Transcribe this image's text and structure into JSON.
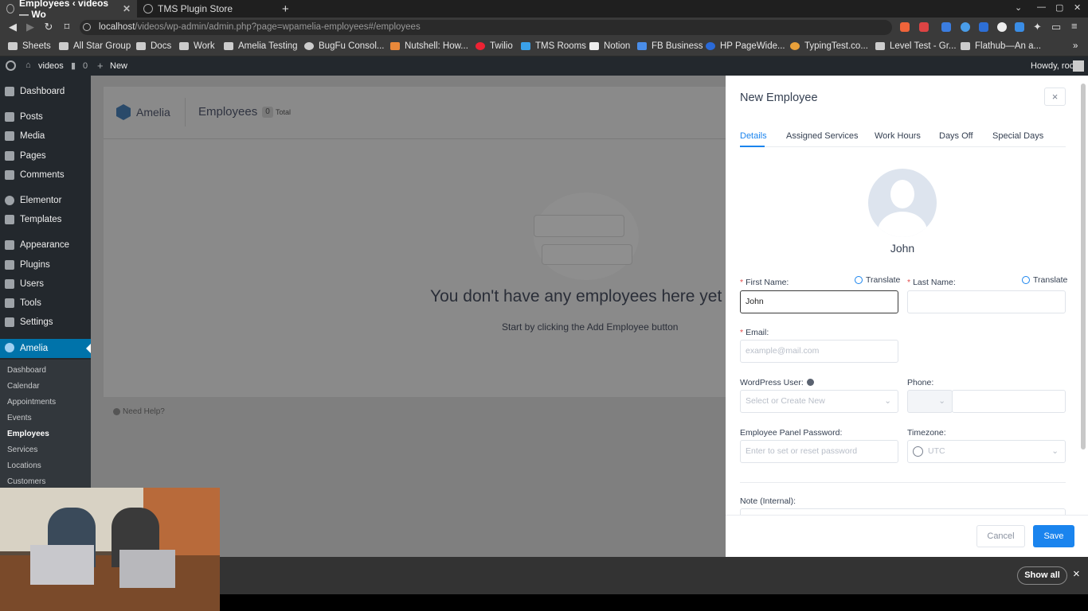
{
  "browser": {
    "tabs": [
      {
        "title": "Employees ‹ videos — Wo",
        "active": true
      },
      {
        "title": "TMS Plugin Store",
        "active": false
      }
    ],
    "new_tab": "+",
    "url_host": "localhost",
    "url_path": "/videos/wp-admin/admin.php?page=wpamelia-employees#/employees",
    "bookmarks": [
      "Sheets",
      "All Star Group",
      "Docs",
      "Work",
      "Amelia Testing",
      "BugFu Consol...",
      "Nutshell: How...",
      "Twilio",
      "TMS Rooms",
      "Notion",
      "FB Business",
      "HP PageWide...",
      "TypingTest.co...",
      "Level Test - Gr...",
      "Flathub—An a..."
    ]
  },
  "adminbar": {
    "site": "videos",
    "comments": "0",
    "new": "New",
    "howdy": "Howdy, root"
  },
  "sidebar": {
    "items": [
      "Dashboard",
      "Posts",
      "Media",
      "Pages",
      "Comments",
      "Elementor",
      "Templates",
      "Appearance",
      "Plugins",
      "Users",
      "Tools",
      "Settings",
      "Amelia"
    ],
    "submenu": [
      "Dashboard",
      "Calendar",
      "Appointments",
      "Events",
      "Employees",
      "Services",
      "Locations",
      "Customers"
    ]
  },
  "main": {
    "brand": "Amelia",
    "page_title": "Employees",
    "count": "0",
    "count_label": "Total",
    "empty_title": "You don't have any employees here yet",
    "empty_sub": "Start by clicking the Add Employee button",
    "help": "Need Help?"
  },
  "panel": {
    "title": "New Employee",
    "close": "×",
    "tabs": [
      "Details",
      "Assigned Services",
      "Work Hours",
      "Days Off",
      "Special Days"
    ],
    "display_name": "John",
    "first_name_label": "First Name:",
    "last_name_label": "Last Name:",
    "translate": "Translate",
    "first_name_value": "John",
    "email_label": "Email:",
    "email_placeholder": "example@mail.com",
    "wp_user_label": "WordPress User:",
    "wp_user_placeholder": "Select or Create New",
    "phone_label": "Phone:",
    "password_label": "Employee Panel Password:",
    "password_placeholder": "Enter to set or reset password",
    "timezone_label": "Timezone:",
    "timezone_value": "UTC",
    "note_label": "Note (Internal):",
    "cancel": "Cancel",
    "save": "Save"
  },
  "downloads": {
    "show_all": "Show all",
    "close": "×"
  },
  "colors": {
    "accent": "#1a84ee",
    "wp_blue": "#0073aa",
    "admin_dark": "#23282d"
  }
}
